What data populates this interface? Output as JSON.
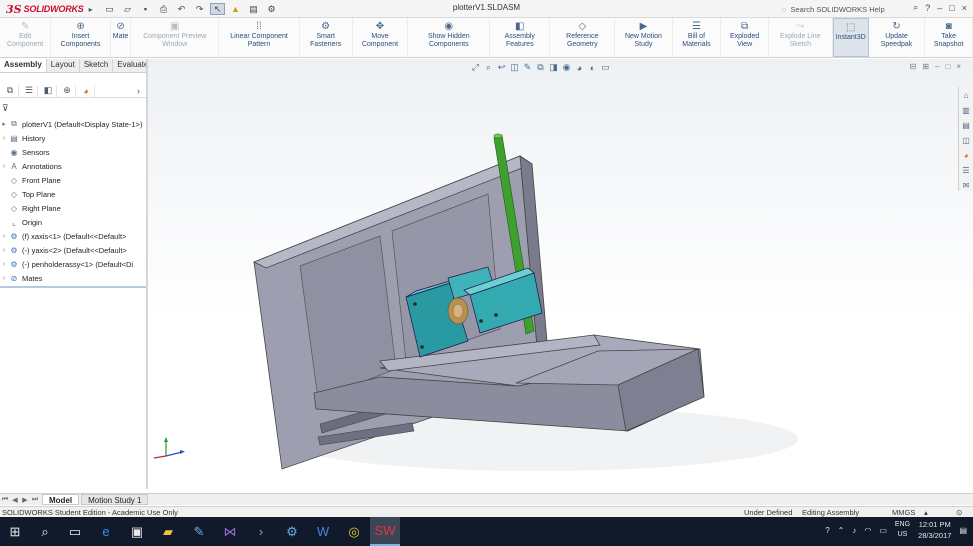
{
  "app": {
    "logo_ds": "3S",
    "logo_name": "SOLIDWORKS",
    "document_title": "plotterV1.SLDASM",
    "search_placeholder": "Search SOLIDWORKS Help",
    "window_buttons": [
      "?",
      "–",
      "□",
      "×"
    ]
  },
  "quick_tools": [
    "new-icon",
    "open-icon",
    "save-icon",
    "print-icon",
    "undo-icon",
    "redo-icon",
    "select-icon",
    "rebuild-icon",
    "options-icon"
  ],
  "command_manager": [
    {
      "label": "Edit Component",
      "icon": "✎",
      "disabled": true
    },
    {
      "label": "Insert Components",
      "icon": "⊕",
      "disabled": false
    },
    {
      "label": "Mate",
      "icon": "⊘",
      "disabled": false
    },
    {
      "label": "Component Preview Window",
      "icon": "▣",
      "disabled": true
    },
    {
      "label": "Linear Component Pattern",
      "icon": "⁞⁞",
      "disabled": false
    },
    {
      "label": "Smart Fasteners",
      "icon": "⚙",
      "disabled": false
    },
    {
      "label": "Move Component",
      "icon": "✥",
      "disabled": false
    },
    {
      "label": "Show Hidden Components",
      "icon": "◉",
      "disabled": false
    },
    {
      "label": "Assembly Features",
      "icon": "◧",
      "disabled": false
    },
    {
      "label": "Reference Geometry",
      "icon": "◇",
      "disabled": false
    },
    {
      "label": "New Motion Study",
      "icon": "▶",
      "disabled": false
    },
    {
      "label": "Bill of Materials",
      "icon": "☰",
      "disabled": false
    },
    {
      "label": "Exploded View",
      "icon": "⧉",
      "disabled": false
    },
    {
      "label": "Explode Line Sketch",
      "icon": "⤳",
      "disabled": true
    },
    {
      "label": "Instant3D",
      "icon": "⬚",
      "disabled": false,
      "active": true
    },
    {
      "label": "Update Speedpak",
      "icon": "↻",
      "disabled": false
    },
    {
      "label": "Take Snapshot",
      "icon": "◙",
      "disabled": false
    }
  ],
  "command_tabs": [
    "Assembly",
    "Layout",
    "Sketch",
    "Evaluate"
  ],
  "feature_manager": {
    "tree": [
      {
        "label": "plotterV1  (Default<Display State-1>)",
        "icon": "⧉",
        "expand": "▸"
      },
      {
        "label": "History",
        "icon": "▤",
        "expand": "›"
      },
      {
        "label": "Sensors",
        "icon": "◉",
        "expand": ""
      },
      {
        "label": "Annotations",
        "icon": "A",
        "expand": "›"
      },
      {
        "label": "Front Plane",
        "icon": "◇",
        "expand": ""
      },
      {
        "label": "Top Plane",
        "icon": "◇",
        "expand": ""
      },
      {
        "label": "Right Plane",
        "icon": "◇",
        "expand": ""
      },
      {
        "label": "Origin",
        "icon": "⌞",
        "expand": ""
      },
      {
        "label": "(f) xaxis<1> (Default<<Default>",
        "icon": "⚙",
        "expand": "›"
      },
      {
        "label": "(-) yaxis<2> (Default<<Default>",
        "icon": "⚙",
        "expand": "›"
      },
      {
        "label": "(-) penholderassy<1> (Default<Di",
        "icon": "⚙",
        "expand": "›"
      },
      {
        "label": "Mates",
        "icon": "⊘",
        "expand": "›"
      }
    ],
    "filter_icon": "filter-icon"
  },
  "bottom_tabs": [
    "Model",
    "Motion Study 1"
  ],
  "status_bar": {
    "left": "SOLIDWORKS Student Edition - Academic Use Only",
    "state": "Under Defined",
    "mode": "Editing Assembly",
    "units": "MMGS",
    "units_caret": "▴"
  },
  "taskbar": {
    "apps": [
      "windows-start-icon",
      "search-icon",
      "task-view-icon",
      "edge-icon",
      "store-icon",
      "file-explorer-icon",
      "notes-icon",
      "visual-studio-icon",
      "powershell-icon",
      "settings-icon",
      "word-icon",
      "chrome-icon",
      "solidworks-icon"
    ],
    "language": "ENG",
    "region": "US",
    "time": "12:01 PM",
    "date": "28/3/2017"
  }
}
